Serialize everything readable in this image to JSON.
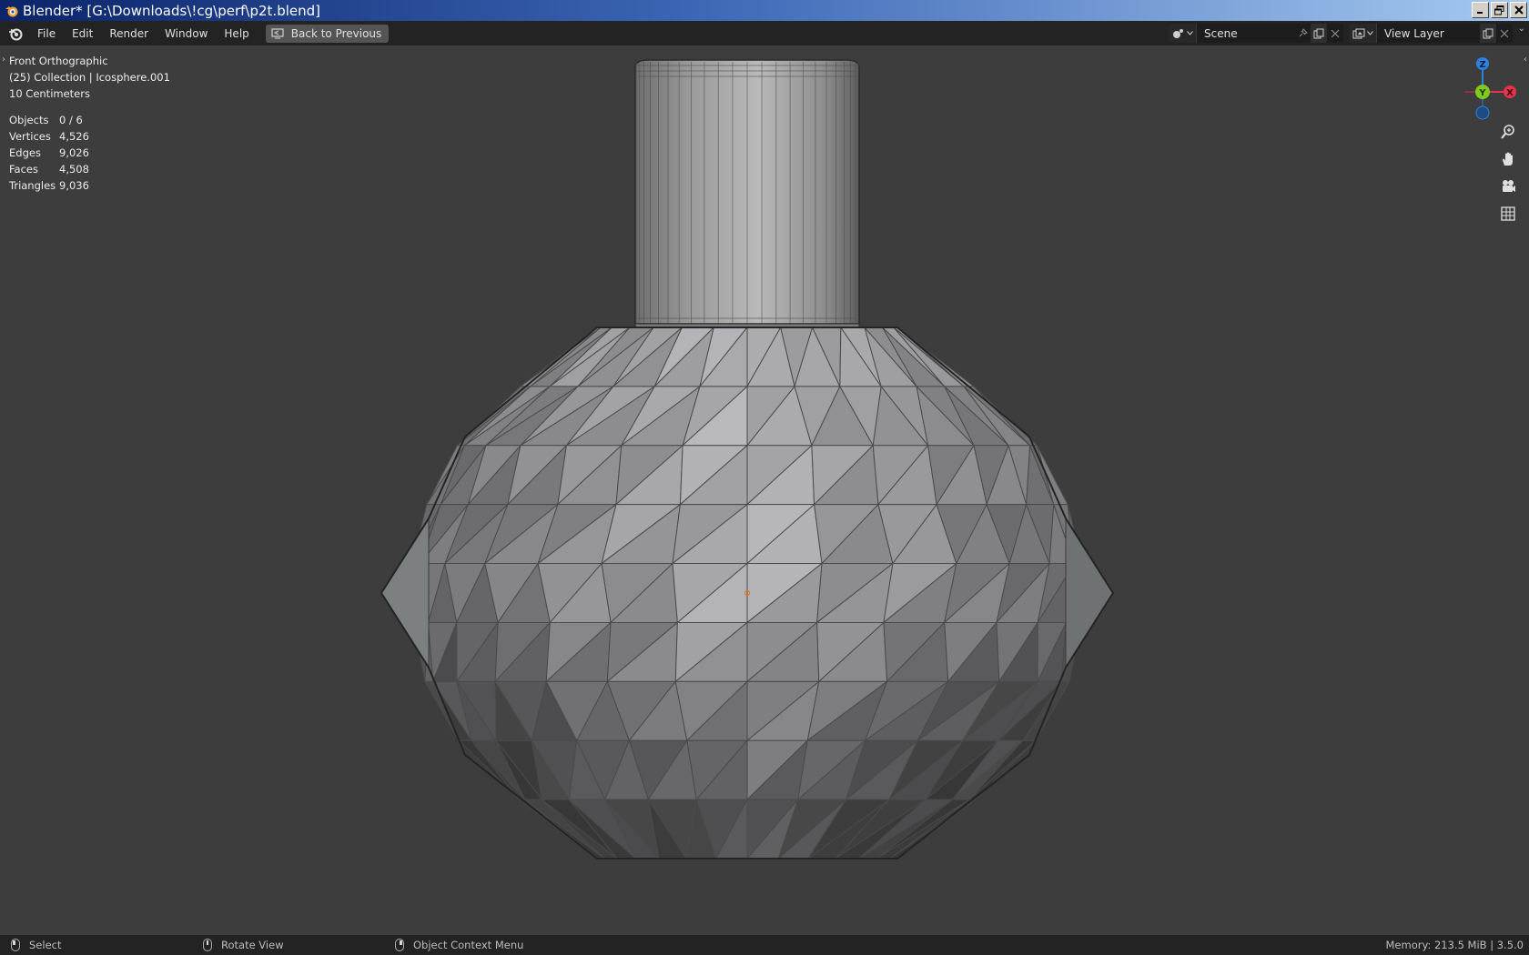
{
  "window": {
    "title": "Blender* [G:\\Downloads\\!cg\\perf\\p2t.blend]",
    "buttons": [
      "minimize",
      "restore",
      "close"
    ]
  },
  "topbar": {
    "menus": [
      "File",
      "Edit",
      "Render",
      "Window",
      "Help"
    ],
    "back_button": "Back to Previous",
    "scene": {
      "value": "Scene"
    },
    "view_layer": {
      "value": "View Layer"
    }
  },
  "viewport": {
    "view_name": "Front Orthographic",
    "collection_info": "(25) Collection | Icosphere.001",
    "scale_info": "10 Centimeters",
    "stats": {
      "objects": {
        "label": "Objects",
        "value": "0 / 6"
      },
      "vertices": {
        "label": "Vertices",
        "value": "4,526"
      },
      "edges": {
        "label": "Edges",
        "value": "9,026"
      },
      "faces": {
        "label": "Faces",
        "value": "4,508"
      },
      "triangles": {
        "label": "Triangles",
        "value": "9,036"
      }
    },
    "gizmo": {
      "z": "Z",
      "y": "Y",
      "x": "X"
    },
    "nav_buttons": [
      "zoom-icon",
      "hand-pan-icon",
      "camera-icon",
      "grid-icon"
    ]
  },
  "statusbar": {
    "select": "Select",
    "rotate": "Rotate View",
    "context": "Object Context Menu",
    "memory": "Memory: 213.5 MiB | 3.5.0"
  },
  "colors": {
    "background": "#3d3d3d",
    "header": "#232323",
    "axis_x": "#e5334c",
    "axis_y": "#7ecb1c",
    "axis_z": "#2f80e3"
  }
}
